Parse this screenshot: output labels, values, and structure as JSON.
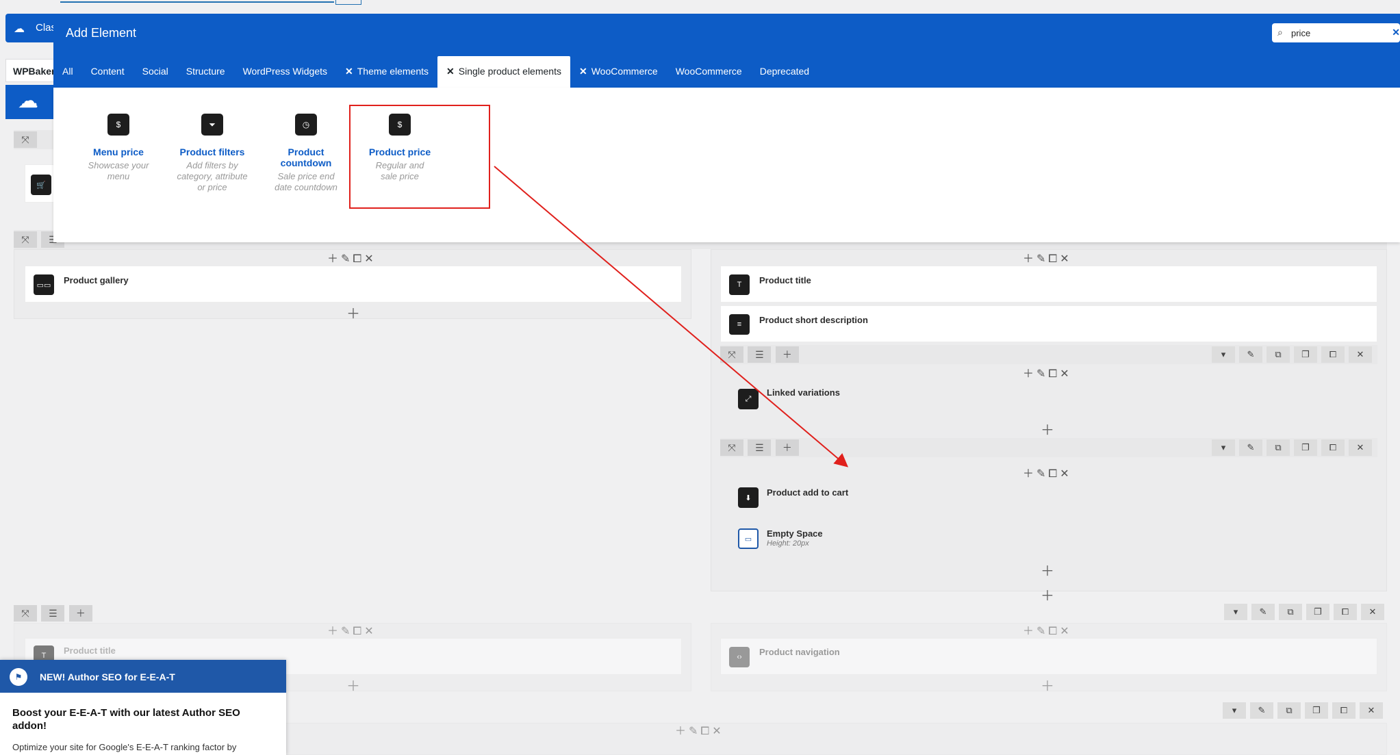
{
  "background": {
    "bar_title": "Clas",
    "tab_label": "WPBaker",
    "elements": {
      "product_gallery": "Product gallery",
      "product_title": "Product title",
      "product_short_description": "Product short description",
      "linked_variations": "Linked variations",
      "product_add_to_cart": "Product add to cart",
      "empty_space": "Empty Space",
      "empty_space_sub": "Height: 20px",
      "product_title_2": "Product title",
      "product_navigation": "Product navigation"
    }
  },
  "modal": {
    "title": "Add Element",
    "search_value": "price",
    "tabs": [
      "All",
      "Content",
      "Social",
      "Structure",
      "WordPress Widgets",
      "Theme elements",
      "Single product elements",
      "WooCommerce",
      "WooCommerce",
      "Deprecated"
    ],
    "active_tab": "Single product elements",
    "cards": [
      {
        "name": "Menu price",
        "desc": "Showcase your menu",
        "icon": "menu-price-icon"
      },
      {
        "name": "Product filters",
        "desc": "Add filters by category, attribute or price",
        "icon": "filter-icon"
      },
      {
        "name": "Product countdown",
        "desc": "Sale price end date countdown",
        "icon": "countdown-icon"
      },
      {
        "name": "Product price",
        "desc": "Regular and sale price",
        "icon": "price-icon"
      }
    ]
  },
  "notice": {
    "title": "NEW! Author SEO for E-E-A-T",
    "heading": "Boost your E-E-A-T with our latest Author SEO addon!",
    "body": "Optimize your site for Google's E-E-A-T ranking factor by"
  },
  "colors": {
    "brand_blue": "#0d5cc6",
    "highlight_red": "#e0201c",
    "notice_blue": "#1f58a8"
  }
}
